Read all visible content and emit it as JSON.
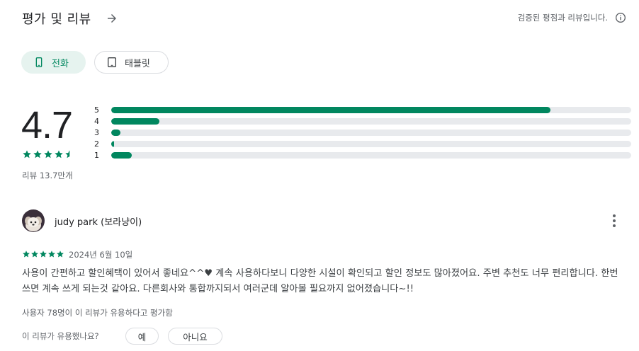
{
  "header": {
    "title": "평가 및 리뷰",
    "arrow_icon": "arrow-right-icon",
    "verified_text": "검증된 평점과 리뷰입니다.",
    "info_icon": "info-icon"
  },
  "device_chips": [
    {
      "label": "전화",
      "icon": "phone-icon",
      "selected": true
    },
    {
      "label": "태블릿",
      "icon": "tablet-icon",
      "selected": false
    }
  ],
  "rating": {
    "average": "4.7",
    "stars": 4.7,
    "review_count_label": "리뷰 13.7만개",
    "distribution": [
      {
        "label": "5",
        "fraction": 0.845
      },
      {
        "label": "4",
        "fraction": 0.092
      },
      {
        "label": "3",
        "fraction": 0.018
      },
      {
        "label": "2",
        "fraction": 0.005
      },
      {
        "label": "1",
        "fraction": 0.04
      }
    ]
  },
  "colors": {
    "accent": "#01875f",
    "chip_selected_bg": "#e6f3ef",
    "track": "#e8eaed"
  },
  "review": {
    "author": "judy park (보라냥이)",
    "stars": 5,
    "date": "2024년 6월 10일",
    "text": "사용이 간편하고 할인혜택이 있어서 좋네요^^♥ 계속 사용하다보니 다양한 시설이 확인되고 할인 정보도 많아졌어요. 주변 추천도 너무 편리합니다. 한번 쓰면 계속 쓰게 되는것 같아요. 다른회사와 통합까지되서 여러군데 알아볼 필요까지 없어졌습니다~!!",
    "helpful_count_text": "사용자 78명이 이 리뷰가 유용하다고 평가함",
    "helpful_question": "이 리뷰가 유용했나요?",
    "yes_label": "예",
    "no_label": "아니요",
    "more_icon": "more-vert-icon"
  }
}
